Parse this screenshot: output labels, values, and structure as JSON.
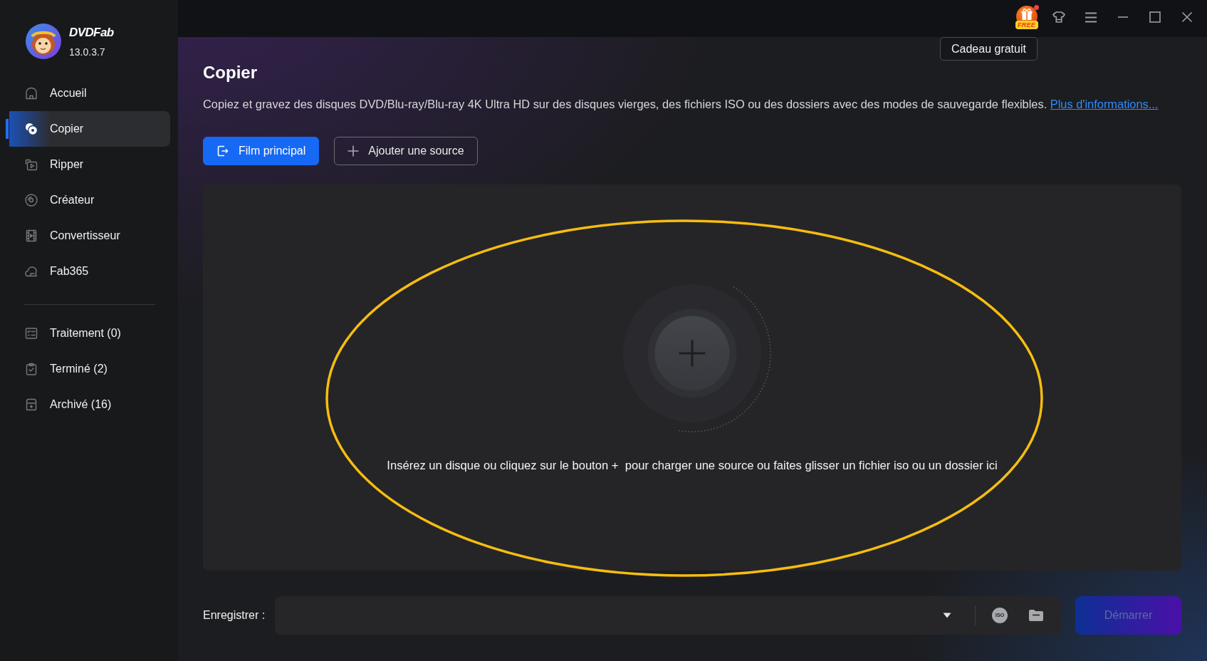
{
  "app": {
    "name": "DVDFab",
    "version": "13.0.3.7"
  },
  "sidebar": {
    "nav_items": [
      {
        "label": "Accueil",
        "selected": false
      },
      {
        "label": "Copier",
        "selected": true
      },
      {
        "label": "Ripper",
        "selected": false
      },
      {
        "label": "Créateur",
        "selected": false
      },
      {
        "label": "Convertisseur",
        "selected": false
      },
      {
        "label": "Fab365",
        "selected": false
      }
    ],
    "queue_items": [
      {
        "label": "Traitement (0)",
        "selected": false
      },
      {
        "label": "Terminé (2)",
        "selected": false
      },
      {
        "label": "Archivé (16)",
        "selected": false
      }
    ]
  },
  "title_bar": {
    "gift_badge": "FREE",
    "notification": true,
    "tooltip": "Cadeau gratuit"
  },
  "page": {
    "title": "Copier",
    "description": "Copiez et gravez des disques DVD/Blu-ray/Blu-ray 4K Ultra HD sur des disques vierges, des fichiers ISO ou des dossiers avec des modes de sauvegarde flexibles.",
    "link": "Plus d'informations...",
    "buttons": [
      {
        "label": "Film principal",
        "kind": "primary"
      },
      {
        "label": "Ajouter une source",
        "kind": "add"
      }
    ]
  },
  "drop_zone": {
    "hint": "Insérez un disque ou cliquez sur le bouton +  pour charger une source ou faites glisser un fichier iso ou un dossier ici",
    "annotations": [
      {
        "kind": "ellipse"
      }
    ]
  },
  "save_bar": {
    "label": "Enregistrer :",
    "iso_button": "ISO",
    "start_button": {
      "label": "Démarrer",
      "disabled": true
    }
  }
}
